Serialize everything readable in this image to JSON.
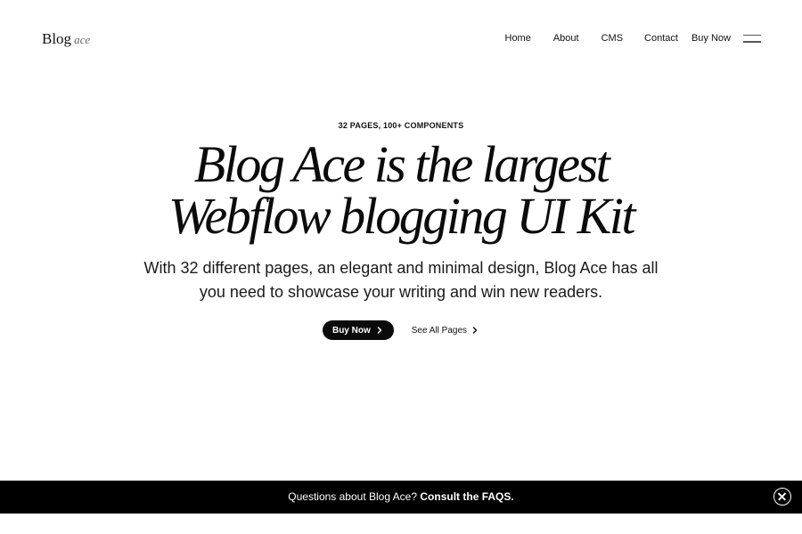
{
  "header": {
    "logo_main": "Blog",
    "logo_sub": "ace",
    "nav": {
      "home": "Home",
      "about": "About",
      "cms": "CMS",
      "contact": "Contact",
      "buy_now": "Buy Now"
    },
    "menu_icon": "hamburger-menu-icon"
  },
  "hero": {
    "eyebrow": "32 PAGES, 100+ COMPONENTS",
    "headline_line1": "Blog Ace is the largest",
    "headline_line2": "Webflow blogging UI Kit",
    "subtext_line1": "With 32 different pages, an elegant and minimal design, Blog Ace has all",
    "subtext_line2": "you need to showcase your writing and win new readers.",
    "primary_cta": "Buy Now",
    "secondary_cta": "See All Pages"
  },
  "banner": {
    "text": "Questions about Blog Ace?",
    "link": "Consult the FAQS.",
    "close_icon": "close-circle-icon"
  },
  "colors": {
    "background": "#ffffff",
    "text": "#111111",
    "banner_bg": "#000000",
    "button_bg": "#0b0b0b"
  }
}
